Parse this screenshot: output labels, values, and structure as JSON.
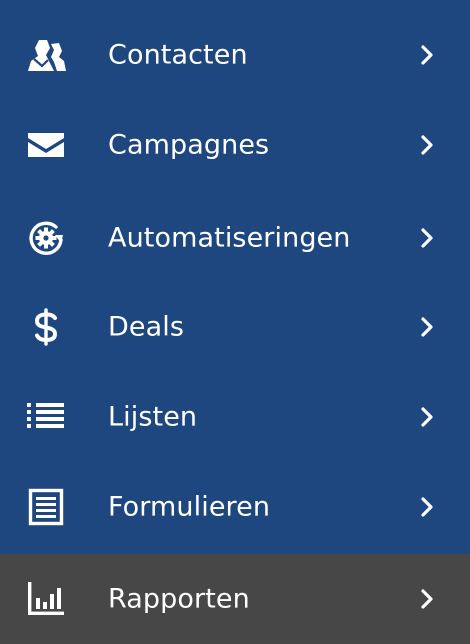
{
  "sidebar": {
    "accent_color": "#1f477f",
    "active_color": "#474747",
    "items": [
      {
        "label": "Contacten",
        "icon": "contacts-icon",
        "active": false
      },
      {
        "label": "Campagnes",
        "icon": "envelope-icon",
        "active": false
      },
      {
        "label": "Automatiseringen",
        "icon": "automation-gear-icon",
        "active": false
      },
      {
        "label": "Deals",
        "icon": "dollar-icon",
        "active": false
      },
      {
        "label": "Lijsten",
        "icon": "list-icon",
        "active": false
      },
      {
        "label": "Formulieren",
        "icon": "form-icon",
        "active": false
      },
      {
        "label": "Rapporten",
        "icon": "bar-chart-icon",
        "active": true
      }
    ]
  }
}
